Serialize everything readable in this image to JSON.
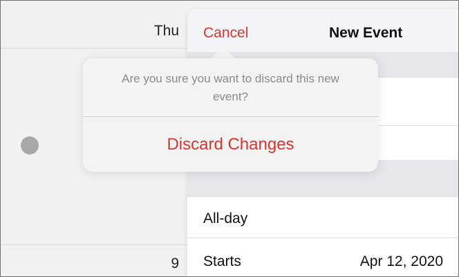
{
  "calendar": {
    "day_label": "Thu",
    "date_label": "9"
  },
  "sheet": {
    "cancel_label": "Cancel",
    "title": "New Event",
    "rows": [
      {
        "label": "All-day",
        "value": ""
      },
      {
        "label": "Starts",
        "value": "Apr 12, 2020"
      }
    ]
  },
  "alert": {
    "message": "Are you sure you want to discard this new event?",
    "discard_label": "Discard Changes"
  },
  "colors": {
    "destructive": "#d8362e",
    "secondary_text": "#8a8a8a",
    "event_dot": "#a8a8a8"
  }
}
